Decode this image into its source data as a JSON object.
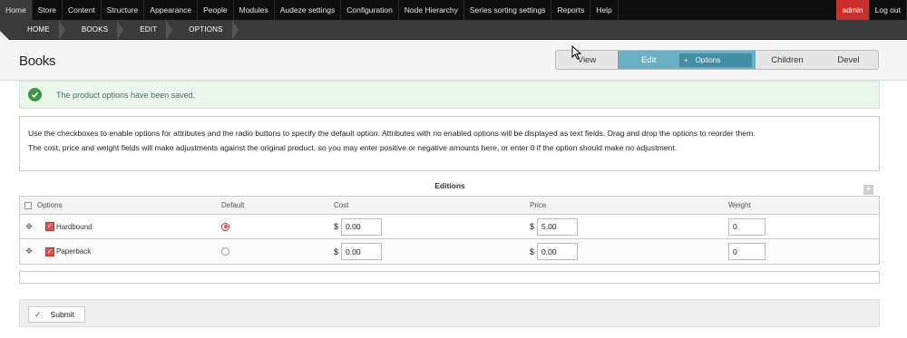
{
  "toolbar": {
    "items": [
      "Home",
      "Store",
      "Content",
      "Structure",
      "Appearance",
      "People",
      "Modules",
      "Audeze settings",
      "Configuration",
      "Node Hierarchy",
      "Series sorting settings",
      "Reports",
      "Help"
    ],
    "user": "admin",
    "logout": "Log out"
  },
  "breadcrumb": [
    "HOME",
    "BOOKS",
    "EDIT",
    "OPTIONS"
  ],
  "page": {
    "title": "Books",
    "tabs": {
      "view": "View",
      "edit": "Edit",
      "options": "Options",
      "children": "Children",
      "devel": "Devel"
    }
  },
  "message": {
    "status": "The product options have been saved."
  },
  "help": {
    "line1": "Use the checkboxes to enable options for attributes and the radio buttons to specify the default option. Attributes with no enabled options will be displayed as text fields. Drag and drop the options to reorder them.",
    "line2": "The cost, price and weight fields will make adjustments against the original product, so you may enter positive or negative amounts here, or enter 0 if the option should make no adjustment."
  },
  "table": {
    "caption": "Editions",
    "headers": {
      "options": "Options",
      "default": "Default",
      "cost": "Cost",
      "price": "Price",
      "weight": "Weight"
    },
    "currency": "$",
    "rows": [
      {
        "label": "Hardbound",
        "cost": "0.00",
        "price": "5.00",
        "weight": "0"
      },
      {
        "label": "Paperback",
        "cost": "0.00",
        "price": "0.00",
        "weight": "0"
      }
    ]
  },
  "actions": {
    "submit": "Submit"
  },
  "colors": {
    "toolbar_bg": "#0f0f0f",
    "active_tab": "#6ab0c5",
    "admin_badge": "#c9302c",
    "success_bg": "#eaf5ec"
  }
}
